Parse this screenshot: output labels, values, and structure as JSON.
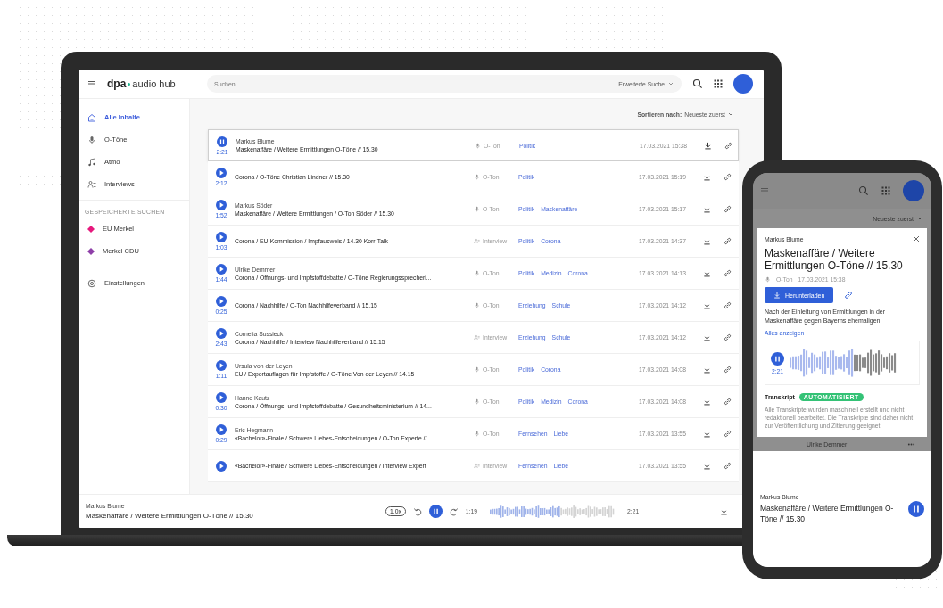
{
  "laptop": {
    "header": {
      "logo_left": "dpa",
      "logo_right": "audio hub",
      "search": {
        "placeholder": "Suchen"
      },
      "advanced_search": "Erweiterte Suche"
    },
    "sidebar": {
      "items": [
        {
          "label": "Alle Inhalte",
          "kind": "home",
          "selected": true
        },
        {
          "label": "O-Töne",
          "kind": "mic",
          "selected": false
        },
        {
          "label": "Atmo",
          "kind": "note",
          "selected": false
        },
        {
          "label": "Interviews",
          "kind": "people",
          "selected": false
        }
      ],
      "saved_heading": "GESPEICHERTE SUCHEN",
      "saved": [
        {
          "label": "EU Merkel",
          "color": "#e6197d",
          "selected": false
        },
        {
          "label": "Merkel CDU",
          "color": "#8e3fa8",
          "selected": false
        }
      ],
      "settings": "Einstellungen"
    },
    "sort": {
      "label": "Sortieren nach:",
      "value": "Neueste zuerst"
    },
    "rows": [
      {
        "speaker": "Markus Blume",
        "title": "Maskenaffäre / Weitere Ermittlungen O-Töne // 15.30",
        "duration": "2:21",
        "kind": "mic",
        "type": "O-Ton",
        "tags": [
          "Politik"
        ],
        "date": "17.03.2021 15:38",
        "playing": true,
        "selected": true
      },
      {
        "title": "Corona / O-Töne Christian Lindner // 15.30",
        "duration": "2:12",
        "kind": "mic",
        "type": "O-Ton",
        "tags": [
          "Politik"
        ],
        "date": "17.03.2021 15:19",
        "playing": false,
        "selected": false
      },
      {
        "speaker": "Markus Söder",
        "title": "Maskenaffäre / Weitere Ermittlungen / O-Ton Söder // 15.30",
        "duration": "1:52",
        "kind": "mic",
        "type": "O-Ton",
        "tags": [
          "Politik",
          "Maskenaffäre"
        ],
        "date": "17.03.2021 15:17",
        "playing": false,
        "selected": false
      },
      {
        "title": "Corona / EU-Kommission / Impfausweis / 14.30 Korr-Talk",
        "duration": "1:03",
        "kind": "people",
        "type": "Interview",
        "tags": [
          "Politik",
          "Corona"
        ],
        "date": "17.03.2021 14:37",
        "playing": false,
        "selected": false
      },
      {
        "speaker": "Ulrike Demmer",
        "title": "Corona / Öffnungs- und Impfstoffdebatte / O-Töne Regierungssprecheri...",
        "duration": "1:44",
        "kind": "mic",
        "type": "O-Ton",
        "tags": [
          "Politik",
          "Medizin",
          "Corona"
        ],
        "date": "17.03.2021 14:13",
        "playing": false,
        "selected": false
      },
      {
        "title": "Corona / Nachhilfe / O-Ton Nachhilfeverband // 15.15",
        "duration": "0:25",
        "kind": "mic",
        "type": "O-Ton",
        "tags": [
          "Erziehung",
          "Schule"
        ],
        "date": "17.03.2021 14:12",
        "playing": false,
        "selected": false
      },
      {
        "speaker": "Cornelia Sussieck",
        "title": "Corona / Nachhilfe / Interview Nachhilfeverband // 15.15",
        "duration": "2:43",
        "kind": "people",
        "type": "Interview",
        "tags": [
          "Erziehung",
          "Schule"
        ],
        "date": "17.03.2021 14:12",
        "playing": false,
        "selected": false
      },
      {
        "speaker": "Ursula von der Leyen",
        "title": "EU / Exportauflagen für Impfstoffe / O-Töne Von der Leyen // 14.15",
        "duration": "1:11",
        "kind": "mic",
        "type": "O-Ton",
        "tags": [
          "Politik",
          "Corona"
        ],
        "date": "17.03.2021 14:08",
        "playing": false,
        "selected": false
      },
      {
        "speaker": "Hanno Kautz",
        "title": "Corona / Öffnungs- und Impfstoffdebatte / Gesundheitsministerium // 14...",
        "duration": "0:30",
        "kind": "mic",
        "type": "O-Ton",
        "tags": [
          "Politik",
          "Medizin",
          "Corona"
        ],
        "date": "17.03.2021 14:08",
        "playing": false,
        "selected": false
      },
      {
        "speaker": "Eric Hegmann",
        "title": "«Bachelor»-Finale / Schwere Liebes-Entscheidungen / O-Ton Experte // ...",
        "duration": "0:29",
        "kind": "mic",
        "type": "O-Ton",
        "tags": [
          "Fernsehen",
          "Liebe"
        ],
        "date": "17.03.2021 13:55",
        "playing": false,
        "selected": false
      },
      {
        "title": "«Bachelor»-Finale / Schwere Liebes-Entscheidungen / Interview Expert",
        "kind": "people",
        "type": "Interview",
        "tags": [
          "Fernsehen",
          "Liebe"
        ],
        "date": "17.03.2021 13:55",
        "playing": false,
        "selected": false
      }
    ],
    "player": {
      "speaker": "Markus Blume",
      "title": "Maskenaffäre / Weitere Ermittlungen O-Töne // 15.30",
      "speed": "1,0x",
      "elapsed": "1:19",
      "total": "2:21",
      "level": 0.56,
      "playing": true
    }
  },
  "phone": {
    "sort": "Neueste zuerst",
    "card": {
      "speaker": "Markus Blume",
      "title": "Maskenaffäre / Weitere Ermittlungen O-Töne // 15.30",
      "type": "O-Ton",
      "date": "17.03.2021 15:38",
      "download": "Herunterladen",
      "description": "Nach der Einleitung von Ermittlungen in der Maskenaffäre gegen Bayerns ehemaligen",
      "more": "Alles anzeigen",
      "duration": "2:21",
      "level": 0.6,
      "playing": true,
      "transcript_label": "Transkript",
      "transcript_badge": "AUTOMATISIERT",
      "transcript": "Alle Transkripte wurden maschinell erstellt und nicht redaktionell bearbeitet. Die Transkripte sind daher nicht zur Veröffentlichung und Zitierung geeignet."
    },
    "behind_row": {
      "speaker": "Ulrike Demmer"
    },
    "player": {
      "speaker": "Markus Blume",
      "title": "Maskenaffäre / Weitere Ermittlungen O-Töne // 15.30",
      "playing": true
    }
  }
}
